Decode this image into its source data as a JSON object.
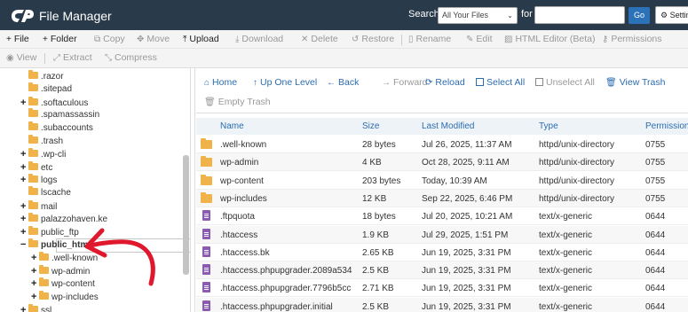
{
  "app": {
    "title": "File Manager",
    "logo": "cpanel-logo"
  },
  "search": {
    "label": "Search",
    "scope": "All Your Files",
    "for_label": "for",
    "value": "",
    "go_label": "Go",
    "settings_label": "Settings"
  },
  "toolbar1": [
    {
      "icon": "plus-icon",
      "glyph": "+",
      "label": "File",
      "active": true
    },
    {
      "icon": "plus-icon",
      "glyph": "+",
      "label": "Folder",
      "active": true
    },
    {
      "icon": "copy-icon",
      "glyph": "⧉",
      "label": "Copy",
      "active": false
    },
    {
      "icon": "move-icon",
      "glyph": "✥",
      "label": "Move",
      "active": false
    },
    {
      "icon": "upload-icon",
      "glyph": "⤒",
      "label": "Upload",
      "active": true
    },
    {
      "icon": "download-icon",
      "glyph": "⤓",
      "label": "Download",
      "active": false
    },
    {
      "icon": "delete-icon",
      "glyph": "✕",
      "label": "Delete",
      "active": false
    },
    {
      "icon": "restore-icon",
      "glyph": "↺",
      "label": "Restore",
      "active": false
    },
    {
      "icon": "rename-icon",
      "glyph": "▯",
      "label": "Rename",
      "active": false
    },
    {
      "icon": "edit-icon",
      "glyph": "✎",
      "label": "Edit",
      "active": false
    },
    {
      "icon": "html-editor-icon",
      "glyph": "▨",
      "label": "HTML Editor (Beta)",
      "active": false
    },
    {
      "icon": "permissions-icon",
      "glyph": "⚷",
      "label": "Permissions",
      "active": false
    }
  ],
  "toolbar2": [
    {
      "icon": "eye-icon",
      "glyph": "◉",
      "label": "View",
      "active": false
    },
    {
      "icon": "extract-icon",
      "glyph": "⤢",
      "label": "Extract",
      "active": false
    },
    {
      "icon": "compress-icon",
      "glyph": "⤡",
      "label": "Compress",
      "active": false
    }
  ],
  "tree": [
    {
      "label": ".razor",
      "pm": "",
      "level": 1
    },
    {
      "label": ".sitepad",
      "pm": "",
      "level": 1
    },
    {
      "label": ".softaculous",
      "pm": "+",
      "level": 1
    },
    {
      "label": ".spamassassin",
      "pm": "",
      "level": 1
    },
    {
      "label": ".subaccounts",
      "pm": "",
      "level": 1
    },
    {
      "label": ".trash",
      "pm": "",
      "level": 1
    },
    {
      "label": ".wp-cli",
      "pm": "+",
      "level": 1
    },
    {
      "label": "etc",
      "pm": "+",
      "level": 1
    },
    {
      "label": "logs",
      "pm": "+",
      "level": 1
    },
    {
      "label": "lscache",
      "pm": "",
      "level": 1
    },
    {
      "label": "mail",
      "pm": "+",
      "level": 1
    },
    {
      "label": "palazzohaven.ke",
      "pm": "+",
      "level": 1
    },
    {
      "label": "public_ftp",
      "pm": "+",
      "level": 1
    },
    {
      "label": "public_html",
      "pm": "−",
      "level": 1,
      "selected": true
    },
    {
      "label": ".well-known",
      "pm": "+",
      "level": 2
    },
    {
      "label": "wp-admin",
      "pm": "+",
      "level": 2
    },
    {
      "label": "wp-content",
      "pm": "+",
      "level": 2
    },
    {
      "label": "wp-includes",
      "pm": "+",
      "level": 2
    },
    {
      "label": "ssl",
      "pm": "+",
      "level": 1
    }
  ],
  "nav": {
    "home": "Home",
    "up": "Up One Level",
    "back": "Back",
    "forward": "Forward",
    "reload": "Reload",
    "select_all": "Select All",
    "unselect_all": "Unselect All",
    "view_trash": "View Trash",
    "empty_trash": "Empty Trash"
  },
  "table": {
    "headers": {
      "name": "Name",
      "size": "Size",
      "modified": "Last Modified",
      "type": "Type",
      "perms": "Permissions"
    },
    "rows": [
      {
        "kind": "folder",
        "name": ".well-known",
        "size": "28 bytes",
        "modified": "Jul 26, 2025, 11:37 AM",
        "type": "httpd/unix-directory",
        "perms": "0755"
      },
      {
        "kind": "folder",
        "name": "wp-admin",
        "size": "4 KB",
        "modified": "Oct 28, 2025, 9:11 AM",
        "type": "httpd/unix-directory",
        "perms": "0755"
      },
      {
        "kind": "folder",
        "name": "wp-content",
        "size": "203 bytes",
        "modified": "Today, 10:39 AM",
        "type": "httpd/unix-directory",
        "perms": "0755"
      },
      {
        "kind": "folder",
        "name": "wp-includes",
        "size": "12 KB",
        "modified": "Sep 22, 2025, 6:46 PM",
        "type": "httpd/unix-directory",
        "perms": "0755"
      },
      {
        "kind": "file",
        "name": ".ftpquota",
        "size": "18 bytes",
        "modified": "Jul 20, 2025, 10:21 AM",
        "type": "text/x-generic",
        "perms": "0644"
      },
      {
        "kind": "file",
        "name": ".htaccess",
        "size": "1.9 KB",
        "modified": "Jul 29, 2025, 1:51 PM",
        "type": "text/x-generic",
        "perms": "0644"
      },
      {
        "kind": "file",
        "name": ".htaccess.bk",
        "size": "2.65 KB",
        "modified": "Jun 19, 2025, 3:31 PM",
        "type": "text/x-generic",
        "perms": "0644"
      },
      {
        "kind": "file",
        "name": ".htaccess.phpupgrader.2089a534",
        "size": "2.5 KB",
        "modified": "Jun 19, 2025, 3:31 PM",
        "type": "text/x-generic",
        "perms": "0644"
      },
      {
        "kind": "file",
        "name": ".htaccess.phpupgrader.7796b5cc",
        "size": "2.71 KB",
        "modified": "Jun 19, 2025, 3:31 PM",
        "type": "text/x-generic",
        "perms": "0644"
      },
      {
        "kind": "file",
        "name": ".htaccess.phpupgrader.initial",
        "size": "2.5 KB",
        "modified": "Jun 19, 2025, 3:31 PM",
        "type": "text/x-generic",
        "perms": "0644"
      }
    ]
  },
  "colors": {
    "header": "#293a4a",
    "accent": "#2b6cb0",
    "folder": "#f0b34a",
    "file": "#8a5bb0",
    "annotation": "#e0182d"
  }
}
